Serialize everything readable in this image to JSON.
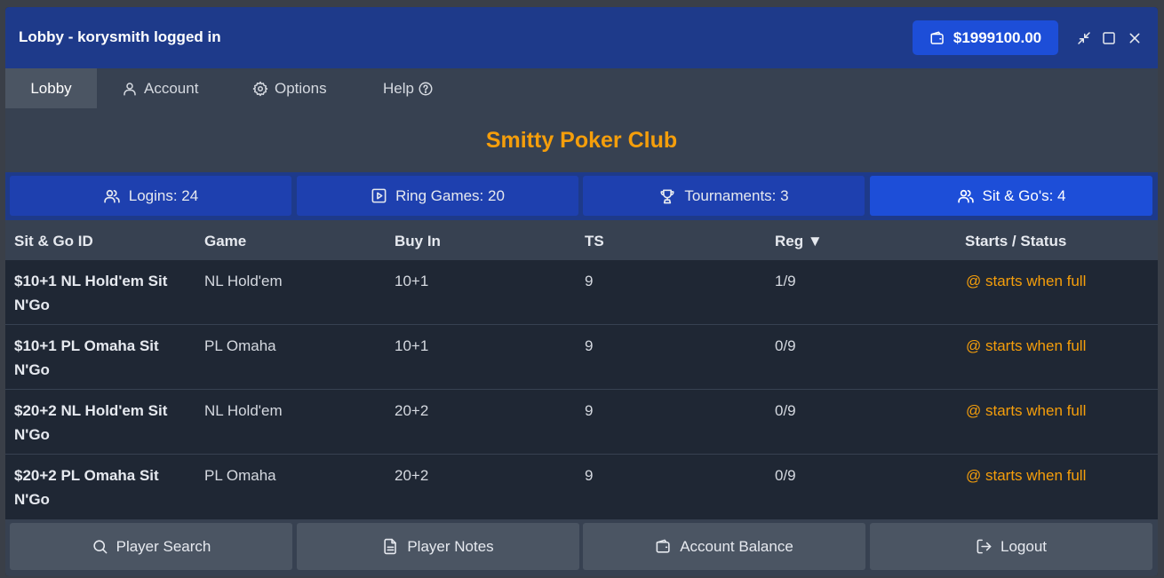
{
  "window": {
    "title": "Lobby - korysmith logged in"
  },
  "wallet": {
    "balance": "$1999100.00",
    "icon": "wallet-icon"
  },
  "menu": {
    "items": [
      {
        "label": "Lobby",
        "icon": ""
      },
      {
        "label": "Account",
        "icon": "user-icon"
      },
      {
        "label": "Options",
        "icon": "gear-icon"
      },
      {
        "label": "Help",
        "icon": "help-circle-icon"
      }
    ]
  },
  "club": {
    "name": "Smitty Poker Club"
  },
  "tabs": [
    {
      "label": "Logins: 24",
      "icon": "users-icon"
    },
    {
      "label": "Ring Games: 20",
      "icon": "play-square-icon"
    },
    {
      "label": "Tournaments: 3",
      "icon": "trophy-icon"
    },
    {
      "label": "Sit & Go's: 4",
      "icon": "users-icon"
    }
  ],
  "table": {
    "headers": [
      "Sit & Go ID",
      "Game",
      "Buy In",
      "TS",
      "Reg ▼",
      "Starts / Status"
    ],
    "rows": [
      {
        "id": "$10+1 NL Hold'em Sit N'Go",
        "game": "NL Hold'em",
        "buyin": "10+1",
        "ts": "9",
        "reg": "1/9",
        "status": "@ starts when full"
      },
      {
        "id": "$10+1 PL Omaha Sit N'Go",
        "game": "PL Omaha",
        "buyin": "10+1",
        "ts": "9",
        "reg": "0/9",
        "status": "@ starts when full"
      },
      {
        "id": "$20+2 NL Hold'em Sit N'Go",
        "game": "NL Hold'em",
        "buyin": "20+2",
        "ts": "9",
        "reg": "0/9",
        "status": "@ starts when full"
      },
      {
        "id": "$20+2 PL Omaha Sit N'Go",
        "game": "PL Omaha",
        "buyin": "20+2",
        "ts": "9",
        "reg": "0/9",
        "status": "@ starts when full"
      }
    ]
  },
  "footer": {
    "buttons": [
      {
        "label": "Player Search",
        "icon": "search-icon"
      },
      {
        "label": "Player Notes",
        "icon": "document-icon"
      },
      {
        "label": "Account Balance",
        "icon": "wallet-icon"
      },
      {
        "label": "Logout",
        "icon": "logout-icon"
      }
    ]
  },
  "colors": {
    "accent": "#f59e0b",
    "titlebar": "#1e3a8a",
    "tab_active": "#1d4ed8"
  }
}
